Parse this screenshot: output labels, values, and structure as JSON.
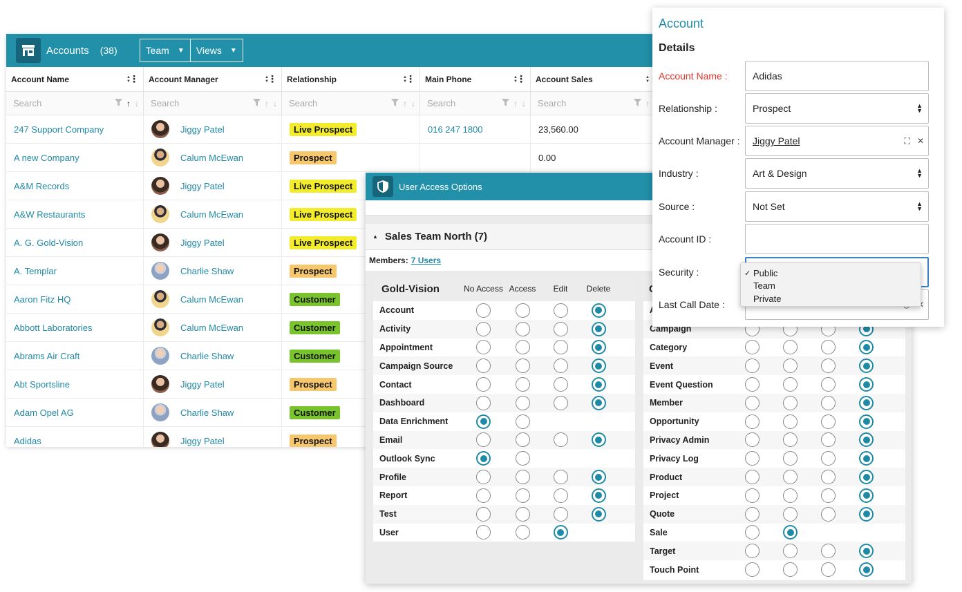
{
  "accounts": {
    "title": "Accounts",
    "count": "(38)",
    "buttons": [
      {
        "label": "Team",
        "caret": "▼"
      },
      {
        "label": "Views",
        "caret": "▼"
      }
    ],
    "columns": [
      "Account Name",
      "Account Manager",
      "Relationship",
      "Main Phone",
      "Account Sales"
    ],
    "search_placeholder": "Search",
    "rows": [
      {
        "name": "247 Support Company",
        "manager": "Jiggy Patel",
        "avatar": "f",
        "relationship": "Live Prospect",
        "phone": "016 247 1800",
        "sales": "23,560.00"
      },
      {
        "name": "A new Company",
        "manager": "Calum McEwan",
        "avatar": "m1",
        "relationship": "Prospect",
        "phone": "",
        "sales": "0.00"
      },
      {
        "name": "A&M Records",
        "manager": "Jiggy Patel",
        "avatar": "f",
        "relationship": "Live Prospect",
        "phone": "",
        "sales": ""
      },
      {
        "name": "A&W Restaurants",
        "manager": "Calum McEwan",
        "avatar": "m1",
        "relationship": "Live Prospect",
        "phone": "",
        "sales": ""
      },
      {
        "name": "A. G. Gold-Vision",
        "manager": "Jiggy Patel",
        "avatar": "f",
        "relationship": "Live Prospect",
        "phone": "",
        "sales": ""
      },
      {
        "name": "A. Templar",
        "manager": "Charlie Shaw",
        "avatar": "m2",
        "relationship": "Prospect",
        "phone": "",
        "sales": ""
      },
      {
        "name": "Aaron Fitz HQ",
        "manager": "Calum McEwan",
        "avatar": "m1",
        "relationship": "Customer",
        "phone": "",
        "sales": ""
      },
      {
        "name": "Abbott Laboratories",
        "manager": "Calum McEwan",
        "avatar": "m1",
        "relationship": "Customer",
        "phone": "",
        "sales": ""
      },
      {
        "name": "Abrams Air Craft",
        "manager": "Charlie Shaw",
        "avatar": "m2",
        "relationship": "Customer",
        "phone": "",
        "sales": ""
      },
      {
        "name": "Abt Sportsline",
        "manager": "Jiggy Patel",
        "avatar": "f",
        "relationship": "Prospect",
        "phone": "",
        "sales": ""
      },
      {
        "name": "Adam Opel AG",
        "manager": "Charlie Shaw",
        "avatar": "m2",
        "relationship": "Customer",
        "phone": "",
        "sales": ""
      },
      {
        "name": "Adidas",
        "manager": "Jiggy Patel",
        "avatar": "f",
        "relationship": "Prospect",
        "phone": "",
        "sales": ""
      }
    ]
  },
  "access": {
    "title": "User Access Options",
    "team": "Sales Team North (7)",
    "members_label": "Members:",
    "members_link": "7 Users",
    "left": {
      "title": "Gold-Vision",
      "headers": [
        "No Access",
        "Access",
        "Edit",
        "Delete"
      ],
      "rows": [
        {
          "name": "Account",
          "opts": [
            0,
            0,
            0,
            1
          ]
        },
        {
          "name": "Activity",
          "opts": [
            0,
            0,
            0,
            1
          ]
        },
        {
          "name": "Appointment",
          "opts": [
            0,
            0,
            0,
            1
          ]
        },
        {
          "name": "Campaign Source",
          "opts": [
            0,
            0,
            0,
            1
          ]
        },
        {
          "name": "Contact",
          "opts": [
            0,
            0,
            0,
            1
          ]
        },
        {
          "name": "Dashboard",
          "opts": [
            0,
            0,
            0,
            1
          ]
        },
        {
          "name": "Data Enrichment",
          "opts": [
            1,
            0
          ]
        },
        {
          "name": "Email",
          "opts": [
            0,
            0,
            0,
            1
          ]
        },
        {
          "name": "Outlook Sync",
          "opts": [
            1,
            0
          ]
        },
        {
          "name": "Profile",
          "opts": [
            0,
            0,
            0,
            1
          ]
        },
        {
          "name": "Report",
          "opts": [
            0,
            0,
            0,
            1
          ]
        },
        {
          "name": "Test",
          "opts": [
            0,
            0,
            0,
            1
          ]
        },
        {
          "name": "User",
          "opts": [
            0,
            0,
            1
          ]
        }
      ]
    },
    "right": {
      "title": "C",
      "rows": [
        {
          "name": "A",
          "opts": []
        },
        {
          "name": "Campaign",
          "opts": [
            0,
            0,
            0,
            1
          ]
        },
        {
          "name": "Category",
          "opts": [
            0,
            0,
            0,
            1
          ]
        },
        {
          "name": "Event",
          "opts": [
            0,
            0,
            0,
            1
          ]
        },
        {
          "name": "Event Question",
          "opts": [
            0,
            0,
            0,
            1
          ]
        },
        {
          "name": "Member",
          "opts": [
            0,
            0,
            0,
            1
          ]
        },
        {
          "name": "Opportunity",
          "opts": [
            0,
            0,
            0,
            1
          ]
        },
        {
          "name": "Privacy Admin",
          "opts": [
            0,
            0,
            0,
            1
          ]
        },
        {
          "name": "Privacy Log",
          "opts": [
            0,
            0,
            0,
            1
          ]
        },
        {
          "name": "Product",
          "opts": [
            0,
            0,
            0,
            1
          ]
        },
        {
          "name": "Project",
          "opts": [
            0,
            0,
            0,
            1
          ]
        },
        {
          "name": "Quote",
          "opts": [
            0,
            0,
            0,
            1
          ]
        },
        {
          "name": "Sale",
          "opts": [
            0,
            1
          ]
        },
        {
          "name": "Target",
          "opts": [
            0,
            0,
            0,
            1
          ]
        },
        {
          "name": "Touch Point",
          "opts": [
            0,
            0,
            0,
            1
          ]
        }
      ]
    }
  },
  "form": {
    "title": "Account",
    "section": "Details",
    "fields": [
      {
        "label": "Account Name :",
        "value": "Adidas",
        "type": "text",
        "required": true
      },
      {
        "label": "Relationship :",
        "value": "Prospect",
        "type": "select"
      },
      {
        "label": "Account Manager :",
        "value": "Jiggy Patel",
        "type": "lookup"
      },
      {
        "label": "Industry :",
        "value": "Art & Design",
        "type": "select"
      },
      {
        "label": "Source :",
        "value": "Not Set",
        "type": "select"
      },
      {
        "label": "Account ID :",
        "value": "",
        "type": "text"
      },
      {
        "label": "Security :",
        "value": "",
        "type": "select-open"
      },
      {
        "label": "Last Call Date :",
        "value": "",
        "type": "date"
      }
    ],
    "security_options": [
      "Public",
      "Team",
      "Private"
    ],
    "security_selected": "Public"
  },
  "colors": {
    "accent": "#2190a8",
    "live_prospect": "#f3ec2c",
    "prospect": "#f7c76d",
    "customer": "#79c42c",
    "required": "#e0312a"
  }
}
